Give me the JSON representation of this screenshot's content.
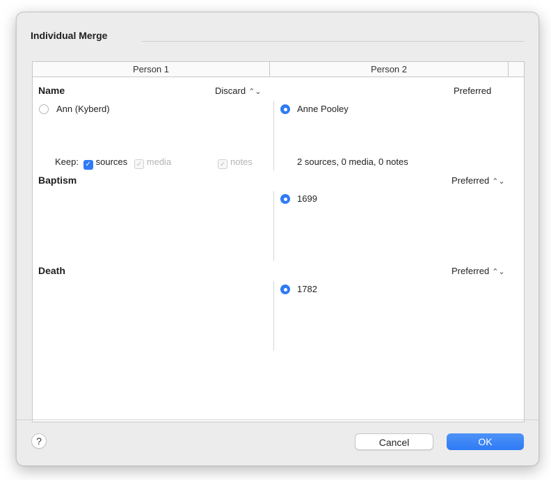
{
  "dialog": {
    "title": "Individual Merge",
    "columns": [
      "Person 1",
      "Person 2",
      ""
    ]
  },
  "name_section": {
    "title": "Name",
    "left_option": "Discard",
    "right_option": "Preferred",
    "person1_value": "Ann (Kyberd)",
    "person1_selected": false,
    "person2_value": "Anne Pooley",
    "person2_selected": true,
    "keep_label": "Keep:",
    "keep_sources": "sources",
    "keep_media": "media",
    "keep_notes": "notes",
    "person2_summary": "2 sources, 0 media, 0 notes"
  },
  "baptism_section": {
    "title": "Baptism",
    "right_option": "Preferred",
    "person2_value": "1699",
    "person2_selected": true
  },
  "death_section": {
    "title": "Death",
    "right_option": "Preferred",
    "person2_value": "1782",
    "person2_selected": true
  },
  "footer": {
    "help_label": "?",
    "cancel_label": "Cancel",
    "ok_label": "OK"
  },
  "icons": {
    "popup": "chevron-updown-icon",
    "check": "checkmark-icon",
    "radio": "radio-icon"
  },
  "colors": {
    "accent": "#2f7bf5",
    "dialog_bg": "#ececec",
    "panel_bg": "#ffffff"
  }
}
